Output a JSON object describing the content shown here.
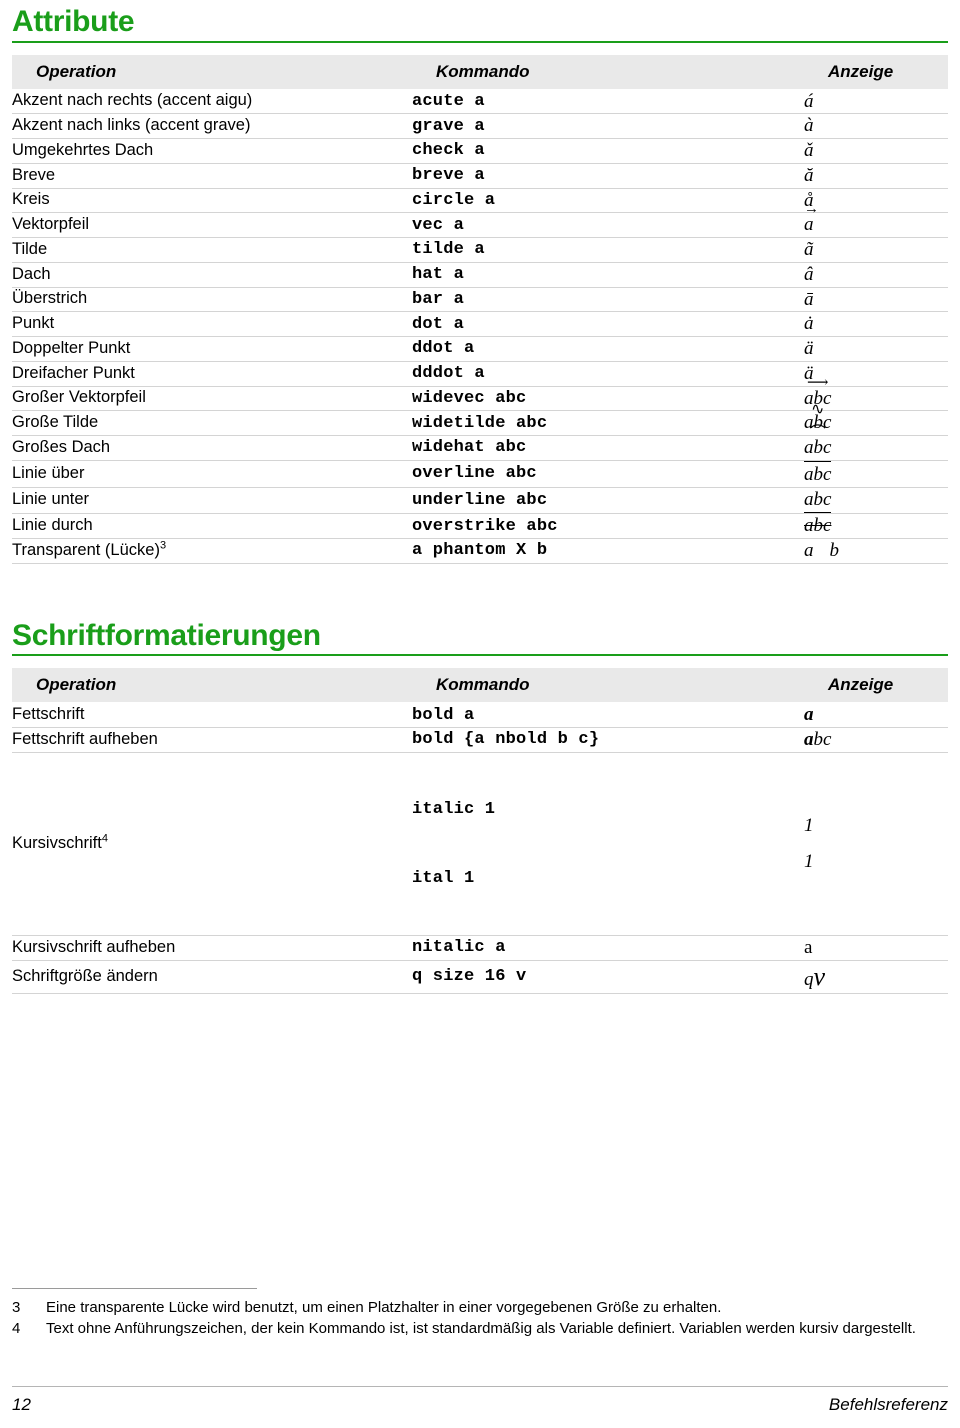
{
  "sections": [
    {
      "heading": "Attribute",
      "columns": [
        "Operation",
        "Kommando",
        "Anzeige"
      ],
      "rows": [
        {
          "operation": "Akzent nach rechts (accent aigu)",
          "command": "acute a",
          "display": "á"
        },
        {
          "operation": "Akzent nach links (accent grave)",
          "command": "grave a",
          "display": "à"
        },
        {
          "operation": "Umgekehrtes Dach",
          "command": "check a",
          "display": "ǎ"
        },
        {
          "operation": "Breve",
          "command": "breve a",
          "display": "ă"
        },
        {
          "operation": "Kreis",
          "command": "circle a",
          "display": "å"
        },
        {
          "operation": "Vektorpfeil",
          "command": "vec a",
          "display": "a⃗"
        },
        {
          "operation": "Tilde",
          "command": "tilde a",
          "display": "ã"
        },
        {
          "operation": "Dach",
          "command": "hat a",
          "display": "â"
        },
        {
          "operation": "Überstrich",
          "command": "bar a",
          "display": "ā"
        },
        {
          "operation": "Punkt",
          "command": "dot a",
          "display": "ȧ"
        },
        {
          "operation": "Doppelter Punkt",
          "command": "ddot a",
          "display": "ä"
        },
        {
          "operation": "Dreifacher Punkt",
          "command": "dddot a",
          "display": "ä"
        },
        {
          "operation": "Großer Vektorpfeil",
          "command": "widevec abc",
          "display": "abc"
        },
        {
          "operation": "Große Tilde",
          "command": "widetilde abc",
          "display": "abc"
        },
        {
          "operation": "Großes Dach",
          "command": "widehat abc",
          "display": "abc"
        },
        {
          "operation": "Linie über",
          "command": "overline abc",
          "display": "abc"
        },
        {
          "operation": "Linie unter",
          "command": "underline abc",
          "display": "abc"
        },
        {
          "operation": "Linie durch",
          "command": "overstrike abc",
          "display": "abc"
        },
        {
          "operation": "Transparent (Lücke)",
          "footnote": "3",
          "command": "a phantom X b",
          "display": "a b"
        }
      ]
    },
    {
      "heading": "Schriftformatierungen",
      "columns": [
        "Operation",
        "Kommando",
        "Anzeige"
      ],
      "rows": [
        {
          "operation": "Fettschrift",
          "command": "bold a",
          "display": "a"
        },
        {
          "operation": "Fettschrift aufheben",
          "command": "bold {a nbold b c}",
          "display_bold": "a",
          "display_rest": "bc"
        },
        {
          "operation": "Kursivschrift",
          "footnote": "4",
          "command_line1": "italic 1",
          "command_line2": "ital 1",
          "display_line1": "1",
          "display_line2": "1"
        },
        {
          "operation": "Kursivschrift aufheben",
          "command": "nitalic a",
          "display": "a"
        },
        {
          "operation": "Schriftgröße ändern",
          "command": "q size 16 v",
          "display_small": "q",
          "display_big": "v"
        }
      ]
    }
  ],
  "footnotes": [
    {
      "num": "3",
      "text": "Eine transparente Lücke wird benutzt, um einen Platzhalter in einer vorgegebenen Größe zu erhalten."
    },
    {
      "num": "4",
      "text": "Text ohne Anführungszeichen, der kein Kommando ist, ist standardmäßig als Variable definiert. Variablen werden kursiv dargestellt."
    }
  ],
  "page_footer": {
    "page_number": "12",
    "document_title": "Befehlsreferenz"
  },
  "colors": {
    "heading_green": "#1a9e1a",
    "table_header_bg": "#e9e9e9",
    "row_rule": "#d4d4d4"
  }
}
